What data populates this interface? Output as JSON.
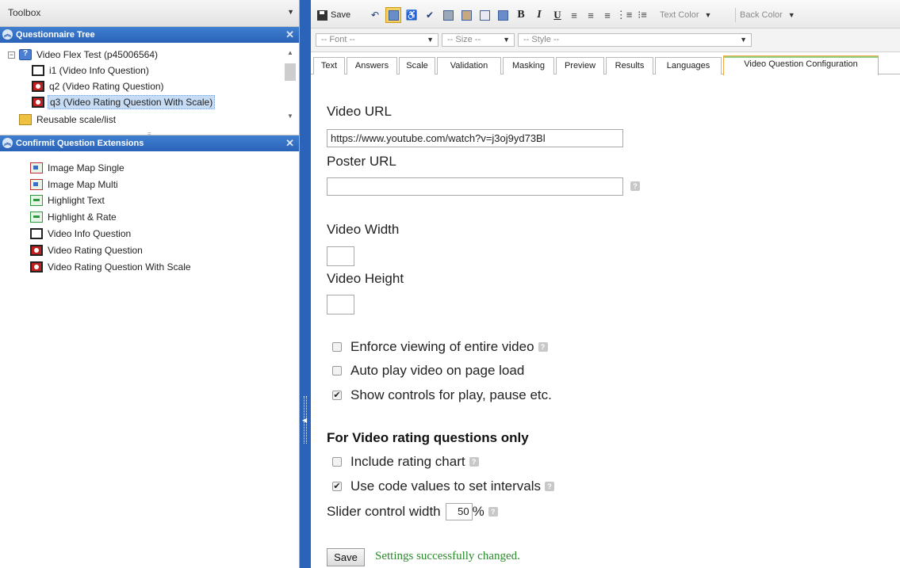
{
  "toolbox": {
    "title": "Toolbox"
  },
  "questionnaire_tree": {
    "title": "Questionnaire Tree",
    "root": "Video Flex Test (p45006564)",
    "items": [
      "i1 (Video Info Question)",
      "q2 (Video Rating Question)",
      "q3 (Video Rating Question With Scale)"
    ],
    "reusable": "Reusable scale/list"
  },
  "extensions": {
    "title": "Confirmit Question Extensions",
    "items": [
      "Image Map Single",
      "Image Map Multi",
      "Highlight Text",
      "Highlight & Rate",
      "Video Info Question",
      "Video Rating Question",
      "Video Rating Question With Scale"
    ]
  },
  "toolbar": {
    "save_label": "Save",
    "text_color": "Text Color",
    "back_color": "Back Color",
    "font_placeholder": "-- Font --",
    "size_placeholder": "-- Size --",
    "style_placeholder": "-- Style --"
  },
  "tabs": [
    "Text",
    "Answers",
    "Scale",
    "Validation",
    "Masking",
    "Preview",
    "Results",
    "Languages",
    "Video Question Configuration"
  ],
  "form": {
    "video_url_label": "Video URL",
    "video_url_value": "https://www.youtube.com/watch?v=j3oj9yd73Bl",
    "poster_url_label": "Poster URL",
    "poster_url_value": "",
    "video_width_label": "Video Width",
    "video_height_label": "Video Height",
    "enforce_label": "Enforce viewing of entire video",
    "autoplay_label": "Auto play video on page load",
    "controls_label": "Show controls for play, pause etc.",
    "rating_section_title": "For Video rating questions only",
    "rating_chart_label": "Include rating chart",
    "code_values_label": "Use code values to set intervals",
    "slider_width_label": "Slider control width",
    "slider_width_value": "50",
    "slider_width_unit": "%",
    "save_button": "Save",
    "status_message": "Settings successfully changed."
  },
  "colors": {
    "panel_header": "#2a63b8",
    "active_tab_border": "#f2a83a",
    "status_green": "#2a8a2a"
  }
}
